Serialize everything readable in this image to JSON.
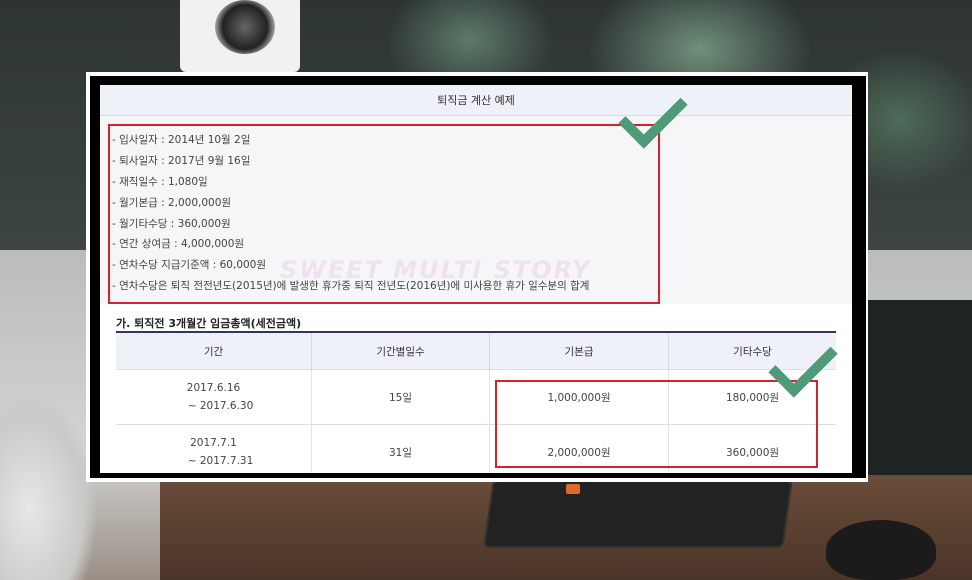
{
  "document": {
    "title": "퇴직금 계산 예제",
    "info_items": [
      "- 입사일자 : 2014년 10월 2일",
      "- 퇴사일자 : 2017년 9월 16일",
      "- 재직일수 : 1,080일",
      "- 월기본급 : 2,000,000원",
      "- 월기타수당 : 360,000원",
      "- 연간 상여금 : 4,000,000원",
      "- 연차수당 지급기준액 : 60,000원",
      "- 연차수당은 퇴직 전전년도(2015년)에 발생한 휴가중 퇴직 전년도(2016년)에 미사용한 휴가 일수분의 합계"
    ],
    "watermark": "SWEET MULTI STORY",
    "section_title": "가. 퇴직전 3개월간 임금총액(세전금액)",
    "table": {
      "headers": [
        "기간",
        "기간별일수",
        "기본급",
        "기타수당"
      ],
      "rows": [
        {
          "period_start": "2017.6.16",
          "period_end": "~ 2017.6.30",
          "days": "15일",
          "base_pay": "1,000,000원",
          "other_allowance": "180,000원"
        },
        {
          "period_start": "2017.7.1",
          "period_end": "~ 2017.7.31",
          "days": "31일",
          "base_pay": "2,000,000원",
          "other_allowance": "360,000원"
        }
      ]
    }
  },
  "colors": {
    "highlight_box": "#d9202b",
    "checkmark": "#4f9a78",
    "header_bg": "#eef1f8",
    "table_rule": "#2d3a5a"
  }
}
